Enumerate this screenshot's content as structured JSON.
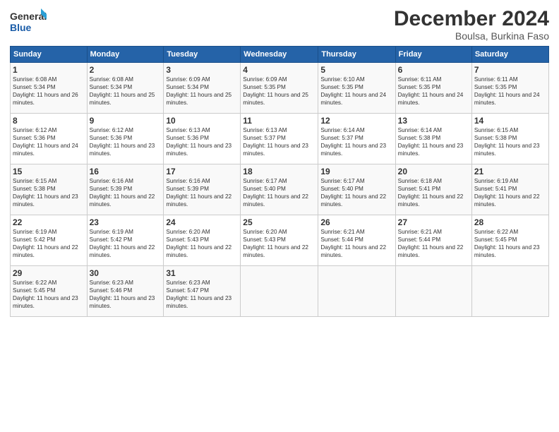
{
  "header": {
    "title": "December 2024",
    "subtitle": "Boulsa, Burkina Faso",
    "logo_general": "General",
    "logo_blue": "Blue"
  },
  "weekdays": [
    "Sunday",
    "Monday",
    "Tuesday",
    "Wednesday",
    "Thursday",
    "Friday",
    "Saturday"
  ],
  "weeks": [
    [
      {
        "day": "1",
        "sr": "6:08 AM",
        "ss": "5:34 PM",
        "dl": "11 hours and 26 minutes."
      },
      {
        "day": "2",
        "sr": "6:08 AM",
        "ss": "5:34 PM",
        "dl": "11 hours and 25 minutes."
      },
      {
        "day": "3",
        "sr": "6:09 AM",
        "ss": "5:34 PM",
        "dl": "11 hours and 25 minutes."
      },
      {
        "day": "4",
        "sr": "6:09 AM",
        "ss": "5:35 PM",
        "dl": "11 hours and 25 minutes."
      },
      {
        "day": "5",
        "sr": "6:10 AM",
        "ss": "5:35 PM",
        "dl": "11 hours and 24 minutes."
      },
      {
        "day": "6",
        "sr": "6:11 AM",
        "ss": "5:35 PM",
        "dl": "11 hours and 24 minutes."
      },
      {
        "day": "7",
        "sr": "6:11 AM",
        "ss": "5:35 PM",
        "dl": "11 hours and 24 minutes."
      }
    ],
    [
      {
        "day": "8",
        "sr": "6:12 AM",
        "ss": "5:36 PM",
        "dl": "11 hours and 24 minutes."
      },
      {
        "day": "9",
        "sr": "6:12 AM",
        "ss": "5:36 PM",
        "dl": "11 hours and 23 minutes."
      },
      {
        "day": "10",
        "sr": "6:13 AM",
        "ss": "5:36 PM",
        "dl": "11 hours and 23 minutes."
      },
      {
        "day": "11",
        "sr": "6:13 AM",
        "ss": "5:37 PM",
        "dl": "11 hours and 23 minutes."
      },
      {
        "day": "12",
        "sr": "6:14 AM",
        "ss": "5:37 PM",
        "dl": "11 hours and 23 minutes."
      },
      {
        "day": "13",
        "sr": "6:14 AM",
        "ss": "5:38 PM",
        "dl": "11 hours and 23 minutes."
      },
      {
        "day": "14",
        "sr": "6:15 AM",
        "ss": "5:38 PM",
        "dl": "11 hours and 23 minutes."
      }
    ],
    [
      {
        "day": "15",
        "sr": "6:15 AM",
        "ss": "5:38 PM",
        "dl": "11 hours and 23 minutes."
      },
      {
        "day": "16",
        "sr": "6:16 AM",
        "ss": "5:39 PM",
        "dl": "11 hours and 22 minutes."
      },
      {
        "day": "17",
        "sr": "6:16 AM",
        "ss": "5:39 PM",
        "dl": "11 hours and 22 minutes."
      },
      {
        "day": "18",
        "sr": "6:17 AM",
        "ss": "5:40 PM",
        "dl": "11 hours and 22 minutes."
      },
      {
        "day": "19",
        "sr": "6:17 AM",
        "ss": "5:40 PM",
        "dl": "11 hours and 22 minutes."
      },
      {
        "day": "20",
        "sr": "6:18 AM",
        "ss": "5:41 PM",
        "dl": "11 hours and 22 minutes."
      },
      {
        "day": "21",
        "sr": "6:19 AM",
        "ss": "5:41 PM",
        "dl": "11 hours and 22 minutes."
      }
    ],
    [
      {
        "day": "22",
        "sr": "6:19 AM",
        "ss": "5:42 PM",
        "dl": "11 hours and 22 minutes."
      },
      {
        "day": "23",
        "sr": "6:19 AM",
        "ss": "5:42 PM",
        "dl": "11 hours and 22 minutes."
      },
      {
        "day": "24",
        "sr": "6:20 AM",
        "ss": "5:43 PM",
        "dl": "11 hours and 22 minutes."
      },
      {
        "day": "25",
        "sr": "6:20 AM",
        "ss": "5:43 PM",
        "dl": "11 hours and 22 minutes."
      },
      {
        "day": "26",
        "sr": "6:21 AM",
        "ss": "5:44 PM",
        "dl": "11 hours and 22 minutes."
      },
      {
        "day": "27",
        "sr": "6:21 AM",
        "ss": "5:44 PM",
        "dl": "11 hours and 22 minutes."
      },
      {
        "day": "28",
        "sr": "6:22 AM",
        "ss": "5:45 PM",
        "dl": "11 hours and 23 minutes."
      }
    ],
    [
      {
        "day": "29",
        "sr": "6:22 AM",
        "ss": "5:45 PM",
        "dl": "11 hours and 23 minutes."
      },
      {
        "day": "30",
        "sr": "6:23 AM",
        "ss": "5:46 PM",
        "dl": "11 hours and 23 minutes."
      },
      {
        "day": "31",
        "sr": "6:23 AM",
        "ss": "5:47 PM",
        "dl": "11 hours and 23 minutes."
      },
      null,
      null,
      null,
      null
    ]
  ]
}
